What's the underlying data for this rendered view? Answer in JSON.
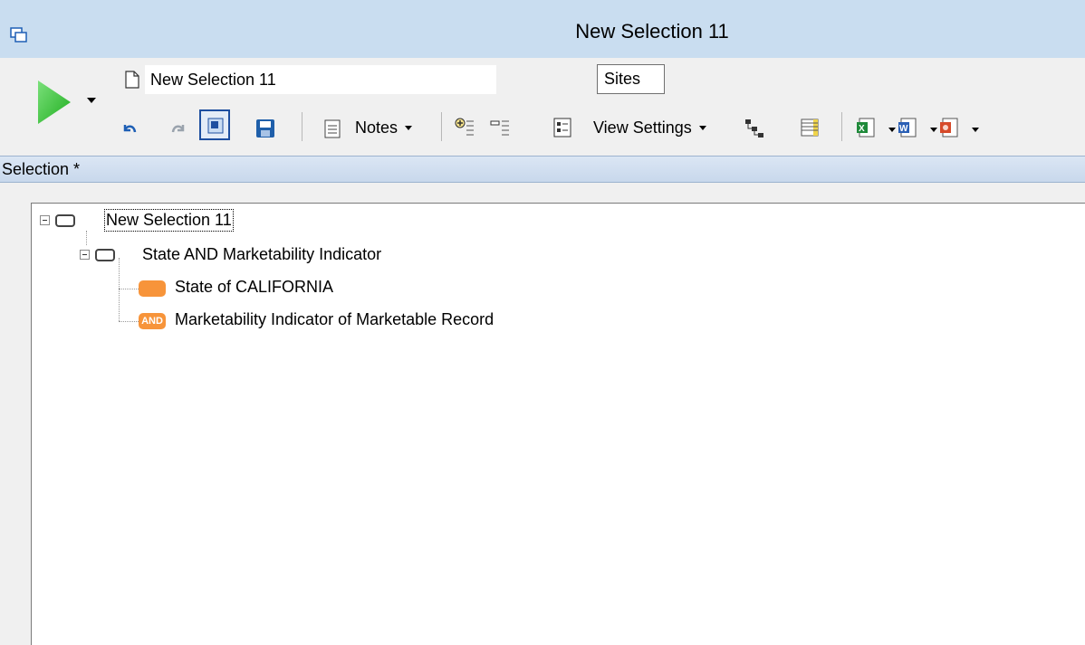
{
  "window": {
    "title": "New Selection 11"
  },
  "toolbar": {
    "selection_name": "New Selection 11",
    "table_name": "Sites",
    "notes_label": "Notes",
    "view_settings_label": "View Settings"
  },
  "section": {
    "label": "Selection *"
  },
  "tree": {
    "root": {
      "label": "New Selection 11"
    },
    "group": {
      "label": "State AND Marketability Indicator"
    },
    "items": [
      {
        "label": "State of CALIFORNIA",
        "badge": ""
      },
      {
        "label": "Marketability Indicator of Marketable Record",
        "badge": "AND"
      }
    ]
  },
  "colors": {
    "accent_orange": "#f7943a",
    "run_green": "#3cc03c",
    "titlebar": "#c9ddf0"
  }
}
